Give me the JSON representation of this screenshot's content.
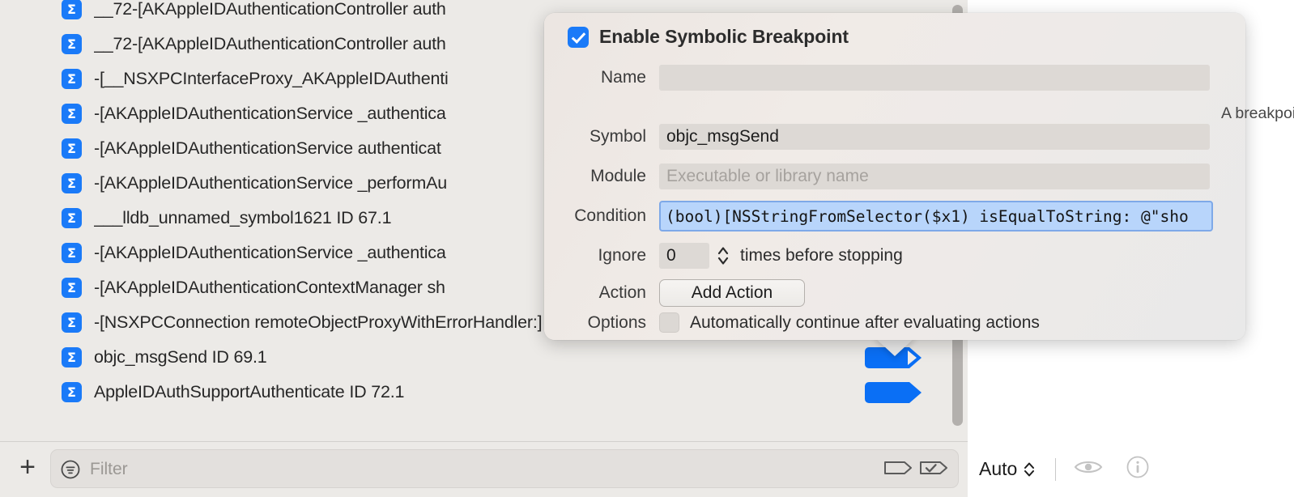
{
  "navigator": {
    "breakpoints": [
      {
        "label": "__72-[AKAppleIDAuthenticationController auth",
        "icon": "sigma-icon",
        "arrow": "none"
      },
      {
        "label": "__72-[AKAppleIDAuthenticationController auth",
        "icon": "sigma-icon",
        "arrow": "none"
      },
      {
        "label": "-[__NSXPCInterfaceProxy_AKAppleIDAuthenti",
        "icon": "sigma-icon",
        "arrow": "none"
      },
      {
        "label": "-[AKAppleIDAuthenticationService _authentica",
        "icon": "sigma-icon",
        "arrow": "none"
      },
      {
        "label": "-[AKAppleIDAuthenticationService authenticat",
        "icon": "sigma-icon",
        "arrow": "none"
      },
      {
        "label": "-[AKAppleIDAuthenticationService _performAu",
        "icon": "sigma-icon",
        "arrow": "none"
      },
      {
        "label": "___lldb_unnamed_symbol1621  ID 67.1",
        "icon": "sigma-icon",
        "arrow": "none"
      },
      {
        "label": "-[AKAppleIDAuthenticationService _authentica",
        "icon": "sigma-icon",
        "arrow": "none"
      },
      {
        "label": "-[AKAppleIDAuthenticationContextManager sh",
        "icon": "sigma-icon",
        "arrow": "none"
      },
      {
        "label": "-[NSXPCConnection remoteObjectProxyWithErrorHandler:]",
        "icon": "sigma-icon",
        "arrow": "none"
      },
      {
        "label": "objc_msgSend  ID 69.1",
        "icon": "sigma-icon",
        "arrow": "notched"
      },
      {
        "label": "AppleIDAuthSupportAuthenticate  ID 72.1",
        "icon": "sigma-icon",
        "arrow": "solid"
      }
    ]
  },
  "toolbar": {
    "add_label": "+",
    "filter_placeholder": "Filter",
    "filter_icon": "filter-circle-icon",
    "toggle_user_breakpoints_icon": "breakpoint-shape-icon",
    "toggle_enabled_breakpoints_icon": "breakpoint-check-icon"
  },
  "inspector_bar": {
    "auto_label": "Auto",
    "stepper_icon": "chevron-up-down-icon",
    "eye_icon": "eye-icon",
    "info_icon": "info-circle-icon"
  },
  "popover": {
    "enable_checkbox_label": "Enable Symbolic Breakpoint",
    "enable_checked": true,
    "fields": {
      "name_label": "Name",
      "name_value": "",
      "name_placeholder": "",
      "name_hint": "A breakpoint name cannot start with numbers or contain any white space.",
      "symbol_label": "Symbol",
      "symbol_value": "objc_msgSend",
      "module_label": "Module",
      "module_value": "",
      "module_placeholder": "Executable or library name",
      "condition_label": "Condition",
      "condition_value": "(bool)[NSStringFromSelector($x1) isEqualToString: @\"sho",
      "ignore_label": "Ignore",
      "ignore_value": "0",
      "ignore_suffix": "times before stopping",
      "action_label": "Action",
      "action_button": "Add Action",
      "options_label": "Options",
      "options_checkbox_label": "Automatically continue after evaluating actions",
      "options_checked": false
    }
  },
  "colors": {
    "accent_blue": "#1a7af8",
    "breakpoint_blue": "#0a6ff5",
    "selection_blue": "#b8d5fb",
    "panel_bg": "#eceae7",
    "popover_bg": "#eeeae8"
  }
}
